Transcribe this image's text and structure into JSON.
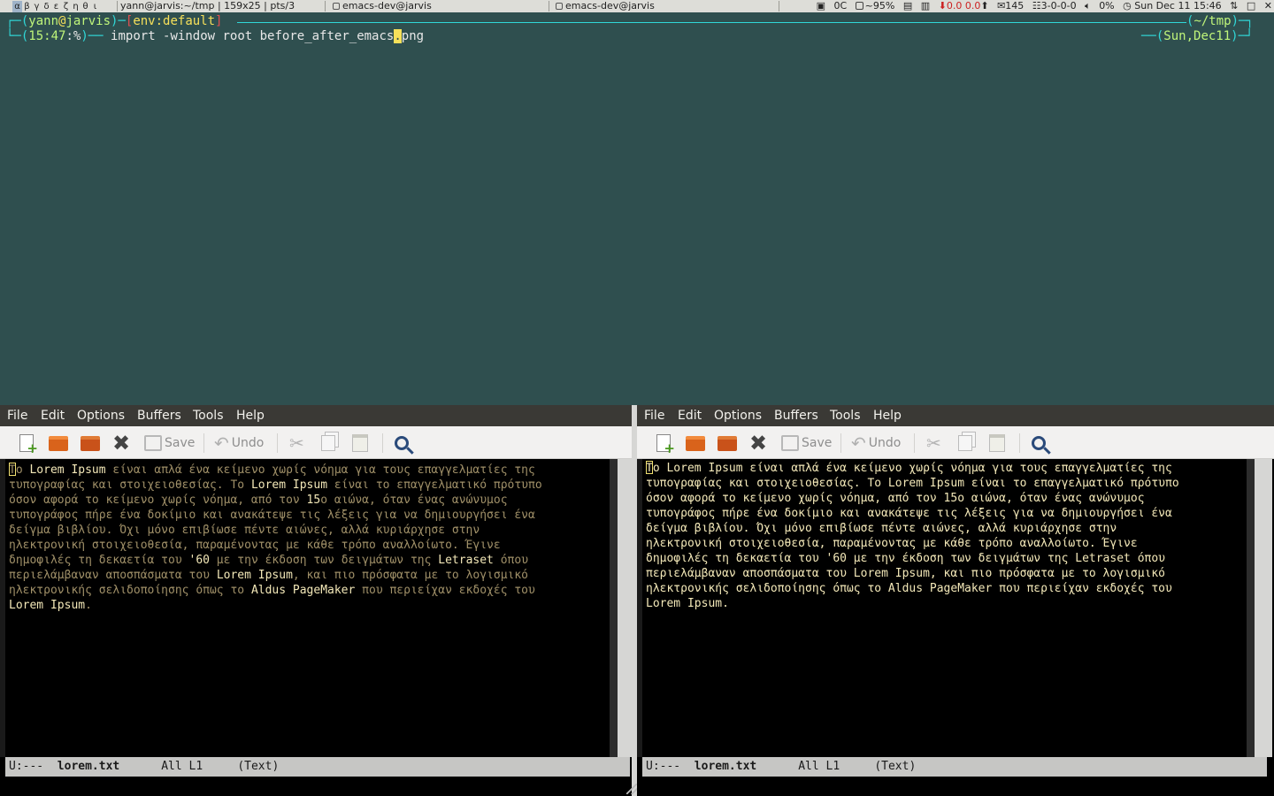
{
  "topbar": {
    "workspaces": [
      "α",
      "β",
      "γ",
      "δ",
      "ε",
      "ζ",
      "η",
      "θ",
      "ι"
    ],
    "active_workspace": 0,
    "tasks": [
      {
        "title": "yann@jarvis:~/tmp | 159x25 | pts/3"
      },
      {
        "title": "emacs-dev@jarvis"
      },
      {
        "title": "emacs-dev@jarvis"
      }
    ],
    "tray": {
      "temp": "0C",
      "battery": "~95%",
      "net": "0.0 0.0",
      "mail": "145",
      "tasks": "3-0-0-0",
      "volume": "0%",
      "clock": "Sun Dec 11 15:46"
    }
  },
  "terminal": {
    "user": "yann",
    "host": "jarvis",
    "env_label": "env:default",
    "cwd": "~/tmp",
    "time": "15:47",
    "prompt_char": "%",
    "command_before_cursor": "import -window root before_after_emacs",
    "cursor_char": ".",
    "command_after_cursor": "png",
    "date": "Sun,Dec11"
  },
  "emacs": {
    "menu": [
      "File",
      "Edit",
      "Options",
      "Buffers",
      "Tools",
      "Help"
    ],
    "toolbar": {
      "save_label": "Save",
      "undo_label": "Undo"
    },
    "left": {
      "modeline": {
        "status": "U:---",
        "buffer": "lorem.txt",
        "position": "All L1",
        "mode": "(Text)"
      }
    },
    "right": {
      "modeline": {
        "status": "U:---",
        "buffer": "lorem.txt",
        "position": "All L1",
        "mode": "(Text)"
      }
    },
    "text_lines": [
      "Το Lorem Ipsum είναι απλά ένα κείμενο χωρίς νόημα για τους επαγγελματίες της",
      "τυπογραφίας και στοιχειοθεσίας. Το Lorem Ipsum είναι το επαγγελματικό πρότυπο",
      "όσον αφορά το κείμενο χωρίς νόημα, από τον 15ο αιώνα, όταν ένας ανώνυμος",
      "τυπογράφος πήρε ένα δοκίμιο και ανακάτεψε τις λέξεις για να δημιουργήσει ένα",
      "δείγμα βιβλίου. Όχι μόνο επιβίωσε πέντε αιώνες, αλλά κυριάρχησε στην",
      "ηλεκτρονική στοιχειοθεσία, παραμένοντας με κάθε τρόπο αναλλοίωτο. Έγινε",
      "δημοφιλές τη δεκαετία του '60 με την έκδοση των δειγμάτων της Letraset όπου",
      "περιελάμβαναν αποσπάσματα του Lorem Ipsum, και πιο πρόσφατα με το λογισμικό",
      "ηλεκτρονικής σελιδοποίησης όπως το Aldus PageMaker που περιείχαν εκδοχές του",
      "Lorem Ipsum."
    ]
  }
}
